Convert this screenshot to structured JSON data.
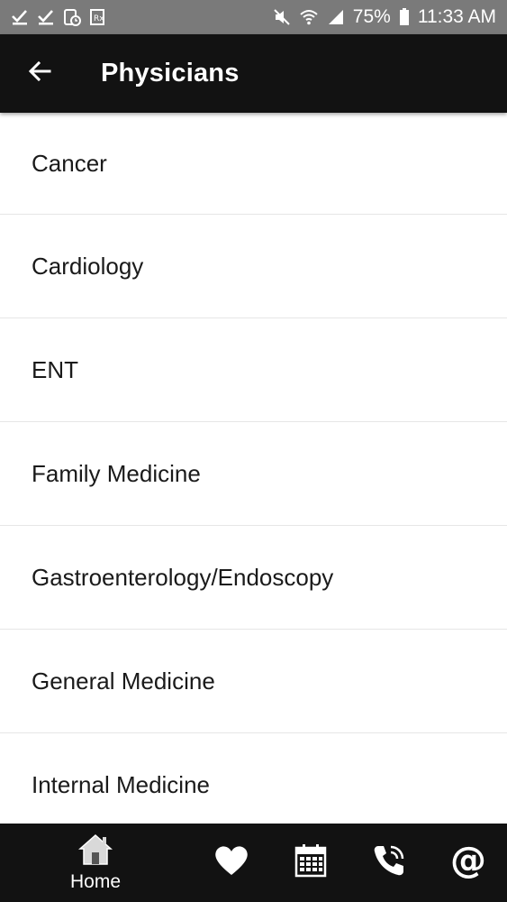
{
  "status_bar": {
    "battery": "75%",
    "time": "11:33 AM",
    "icons_left": [
      "check-icon",
      "check-icon",
      "device-clock-icon",
      "prescription-icon"
    ],
    "icons_right": [
      "mute-icon",
      "wifi-icon",
      "signal-icon",
      "battery-icon"
    ]
  },
  "app_bar": {
    "title": "Physicians",
    "back_icon": "arrow-left-icon"
  },
  "list": {
    "items": [
      {
        "label": "Cancer"
      },
      {
        "label": "Cardiology"
      },
      {
        "label": "ENT"
      },
      {
        "label": "Family Medicine"
      },
      {
        "label": "Gastroenterology/Endoscopy"
      },
      {
        "label": "General Medicine"
      },
      {
        "label": "Internal Medicine"
      }
    ]
  },
  "bottom_nav": {
    "items": [
      {
        "icon": "home-icon",
        "label": "Home"
      },
      {
        "icon": "heart-icon"
      },
      {
        "icon": "calendar-icon"
      },
      {
        "icon": "phone-icon"
      },
      {
        "icon": "at-sign-icon"
      }
    ]
  },
  "colors": {
    "status_bar": "#7a7a7a",
    "app_bar": "#121212",
    "background": "#ffffff",
    "divider": "#e6e6e6"
  }
}
